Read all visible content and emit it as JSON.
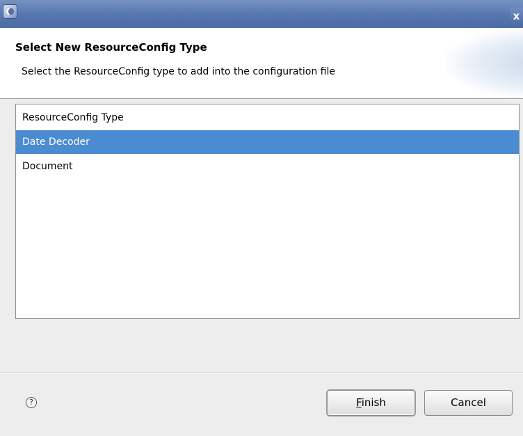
{
  "window": {
    "title": "",
    "close_glyph": "x"
  },
  "header": {
    "title": "Select New ResourceConfig Type",
    "description": "Select the ResourceConfig type to add into the configuration file"
  },
  "list": {
    "items": [
      {
        "label": "ResourceConfig Type",
        "selected": false
      },
      {
        "label": "Date Decoder",
        "selected": true
      },
      {
        "label": "Document",
        "selected": false
      }
    ]
  },
  "footer": {
    "help_glyph": "?",
    "finish_mnemonic": "F",
    "finish_rest": "inish",
    "cancel_label": "Cancel"
  },
  "colors": {
    "titlebar": "#5577ae",
    "selection": "#4a8bd1",
    "dialog_bg": "#ededed"
  },
  "icons": {
    "app": "eclipse-icon",
    "close": "close-icon",
    "help": "help-icon"
  }
}
